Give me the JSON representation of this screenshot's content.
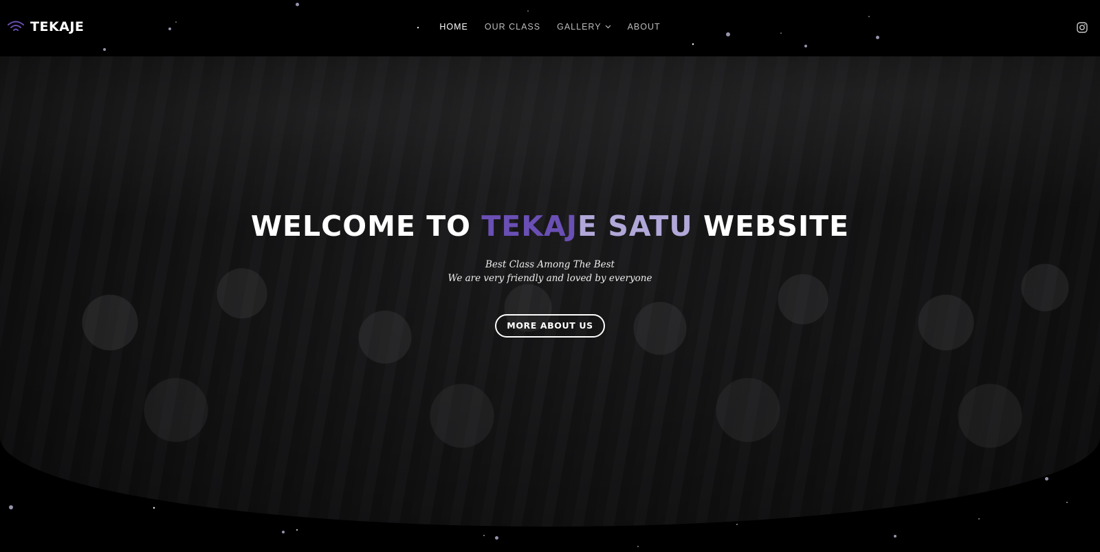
{
  "brand": {
    "name": "TEKAJE",
    "icon": "wifi-icon",
    "accent": "#6a4fb4"
  },
  "nav": {
    "items": [
      {
        "label": "HOME",
        "active": true
      },
      {
        "label": "OUR CLASS",
        "active": false
      },
      {
        "label": "GALLERY",
        "active": false,
        "has_dropdown": true
      },
      {
        "label": "ABOUT",
        "active": false
      }
    ],
    "dropdown_icon": "chevron-down-icon",
    "social_icon": "instagram-icon"
  },
  "hero": {
    "title_part1": "WELCOME TO ",
    "title_part2": "TEKAJ",
    "title_part3": "E SATU",
    "title_part4": "",
    "title_part5": " WEBSITE",
    "subtitle_line1": "Best Class Among The Best",
    "subtitle_line2": "We are very friendly and loved by everyone",
    "cta_label": "MORE ABOUT US"
  },
  "colors": {
    "background": "#000000",
    "highlight_dark": "#6a4fb4",
    "highlight_light": "#b1a7d8"
  }
}
